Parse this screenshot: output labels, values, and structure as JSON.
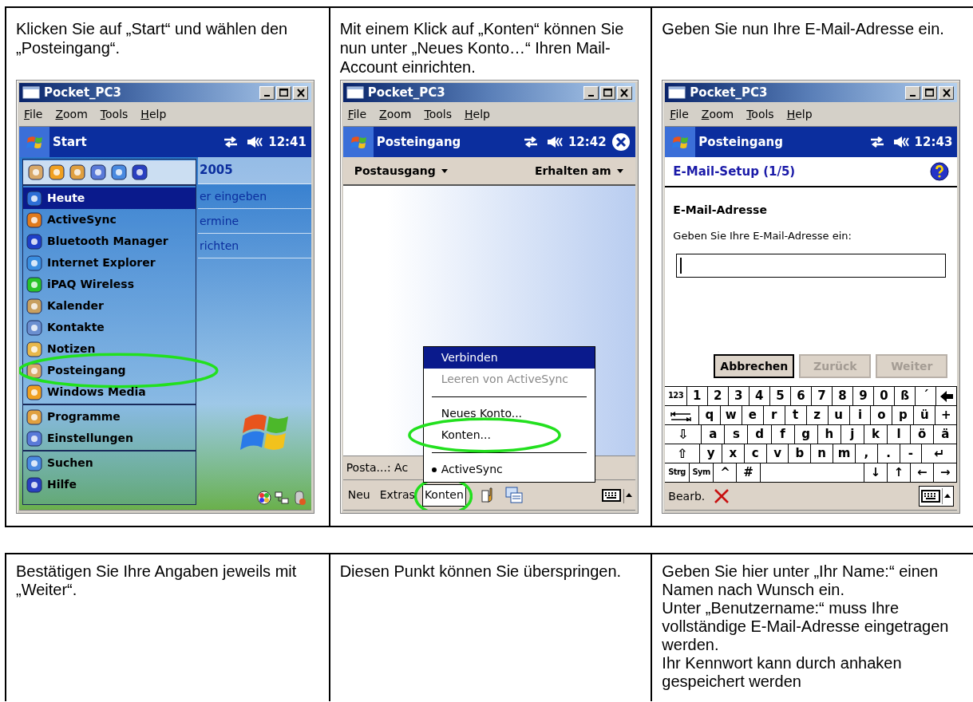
{
  "top_row": [
    {
      "instruction": "Klicken Sie auf „Start“ und wählen den „Posteingang“.",
      "device": {
        "kind": "start_menu",
        "window_title": "Pocket_PC3",
        "menu": [
          "File",
          "Zoom",
          "Tools",
          "Help"
        ],
        "nav_title": "Start",
        "time": "12:41",
        "today_items": [
          "2005",
          "er eingeben",
          "ermine",
          "richten"
        ],
        "menu_groups": [
          [
            {
              "label": "Heute",
              "selected": true,
              "circled": false
            },
            {
              "label": "ActiveSync",
              "selected": false,
              "circled": false
            },
            {
              "label": "Bluetooth Manager",
              "selected": false,
              "circled": false
            },
            {
              "label": "Internet Explorer",
              "selected": false,
              "circled": false
            },
            {
              "label": "iPAQ Wireless",
              "selected": false,
              "circled": false
            },
            {
              "label": "Kalender",
              "selected": false,
              "circled": false
            },
            {
              "label": "Kontakte",
              "selected": false,
              "circled": false
            },
            {
              "label": "Notizen",
              "selected": false,
              "circled": false
            },
            {
              "label": "Posteingang",
              "selected": false,
              "circled": true
            },
            {
              "label": "Windows Media",
              "selected": false,
              "circled": false
            }
          ],
          [
            {
              "label": "Programme",
              "selected": false,
              "circled": false
            },
            {
              "label": "Einstellungen",
              "selected": false,
              "circled": false
            }
          ],
          [
            {
              "label": "Suchen",
              "selected": false,
              "circled": false
            },
            {
              "label": "Hilfe",
              "selected": false,
              "circled": false
            }
          ]
        ]
      }
    },
    {
      "instruction": "Mit einem Klick auf „Konten“ können Sie nun unter „Neues Konto…“ Ihren Mail-Account einrichten.",
      "device": {
        "kind": "inbox_menu",
        "window_title": "Pocket_PC3",
        "menu": [
          "File",
          "Zoom",
          "Tools",
          "Help"
        ],
        "nav_title": "Posteingang",
        "time": "12:42",
        "folder": "Postausgang",
        "sort": "Erhalten am",
        "popup": [
          {
            "kind": "item",
            "label": "Verbinden",
            "selected": true,
            "disabled": false,
            "checked": false,
            "circled": false
          },
          {
            "kind": "item",
            "label": "Leeren von ActiveSync",
            "selected": false,
            "disabled": true,
            "checked": false,
            "circled": false
          },
          {
            "kind": "separator"
          },
          {
            "kind": "item",
            "label": "Neues Konto...",
            "selected": false,
            "disabled": false,
            "checked": false,
            "circled": false
          },
          {
            "kind": "item",
            "label": "Konten...",
            "selected": false,
            "disabled": false,
            "checked": false,
            "circled": true
          },
          {
            "kind": "separator"
          },
          {
            "kind": "item",
            "label": "ActiveSync",
            "selected": false,
            "disabled": false,
            "checked": true,
            "circled": false
          }
        ],
        "status": "Posta...: Ac",
        "toolbar": [
          {
            "label": "Neu",
            "selected": false,
            "circled": false
          },
          {
            "label": "Extras",
            "selected": false,
            "circled": false
          },
          {
            "label": "Konten",
            "selected": true,
            "circled": true
          }
        ]
      }
    },
    {
      "instruction": "Geben Sie nun Ihre E-Mail-Adresse ein.",
      "device": {
        "kind": "email_setup",
        "window_title": "Pocket_PC3",
        "menu": [
          "File",
          "Zoom",
          "Tools",
          "Help"
        ],
        "nav_title": "Posteingang",
        "time": "12:43",
        "heading": "E-Mail-Setup (1/5)",
        "section": "E-Mail-Adresse",
        "prompt": "Geben Sie Ihre E-Mail-Adresse ein:",
        "buttons": [
          {
            "label": "Abbrechen",
            "disabled": false
          },
          {
            "label": "Zurück",
            "disabled": true
          },
          {
            "label": "Weiter",
            "disabled": true
          }
        ],
        "keyboard": [
          [
            {
              "kind": "small",
              "label": "123"
            },
            {
              "kind": "char",
              "label": "1"
            },
            {
              "kind": "char",
              "label": "2"
            },
            {
              "kind": "char",
              "label": "3"
            },
            {
              "kind": "char",
              "label": "4"
            },
            {
              "kind": "char",
              "label": "5"
            },
            {
              "kind": "char",
              "label": "6"
            },
            {
              "kind": "char",
              "label": "7"
            },
            {
              "kind": "char",
              "label": "8"
            },
            {
              "kind": "char",
              "label": "9"
            },
            {
              "kind": "char",
              "label": "0"
            },
            {
              "kind": "char",
              "label": "ß"
            },
            {
              "kind": "char",
              "label": "´"
            },
            {
              "kind": "backspace"
            }
          ],
          [
            {
              "kind": "tab"
            },
            {
              "kind": "char",
              "label": "q"
            },
            {
              "kind": "char",
              "label": "w"
            },
            {
              "kind": "char",
              "label": "e"
            },
            {
              "kind": "char",
              "label": "r"
            },
            {
              "kind": "char",
              "label": "t"
            },
            {
              "kind": "char",
              "label": "z"
            },
            {
              "kind": "char",
              "label": "u"
            },
            {
              "kind": "char",
              "label": "i"
            },
            {
              "kind": "char",
              "label": "o"
            },
            {
              "kind": "char",
              "label": "p"
            },
            {
              "kind": "char",
              "label": "ü"
            },
            {
              "kind": "char",
              "label": "+"
            }
          ],
          [
            {
              "kind": "wide",
              "label": "⇩"
            },
            {
              "kind": "char",
              "label": "a"
            },
            {
              "kind": "char",
              "label": "s"
            },
            {
              "kind": "char",
              "label": "d"
            },
            {
              "kind": "char",
              "label": "f"
            },
            {
              "kind": "char",
              "label": "g"
            },
            {
              "kind": "char",
              "label": "h"
            },
            {
              "kind": "char",
              "label": "j"
            },
            {
              "kind": "char",
              "label": "k"
            },
            {
              "kind": "char",
              "label": "l"
            },
            {
              "kind": "char",
              "label": "ö"
            },
            {
              "kind": "char",
              "label": "ä"
            }
          ],
          [
            {
              "kind": "wide",
              "label": "⇧"
            },
            {
              "kind": "char",
              "label": "y"
            },
            {
              "kind": "char",
              "label": "x"
            },
            {
              "kind": "char",
              "label": "c"
            },
            {
              "kind": "char",
              "label": "v"
            },
            {
              "kind": "char",
              "label": "b"
            },
            {
              "kind": "char",
              "label": "n"
            },
            {
              "kind": "char",
              "label": "m"
            },
            {
              "kind": "char",
              "label": ","
            },
            {
              "kind": "char",
              "label": "."
            },
            {
              "kind": "char",
              "label": "-"
            },
            {
              "kind": "wide",
              "label": "↵"
            }
          ],
          [
            {
              "kind": "small",
              "label": "Strg"
            },
            {
              "kind": "small",
              "label": "Sym"
            },
            {
              "kind": "char",
              "label": "^"
            },
            {
              "kind": "char",
              "label": "#"
            },
            {
              "kind": "space"
            },
            {
              "kind": "char",
              "label": "↓"
            },
            {
              "kind": "char",
              "label": "↑"
            },
            {
              "kind": "char",
              "label": "←"
            },
            {
              "kind": "char",
              "label": "→"
            }
          ]
        ],
        "edit_label": "Bearb."
      }
    }
  ],
  "bottom_row": [
    {
      "instruction": "Bestätigen Sie Ihre Angaben jeweils mit „Weiter“."
    },
    {
      "instruction": "Diesen Punkt können Sie überspringen."
    },
    {
      "instruction": "Geben Sie hier unter „Ihr Name:“ einen Namen nach Wunsch ein.\nUnter „Benutzername:“ muss Ihre vollständige E-Mail-Adresse eingetragen werden.\nIhr Kennwort kann durch anhaken gespeichert werden"
    }
  ]
}
